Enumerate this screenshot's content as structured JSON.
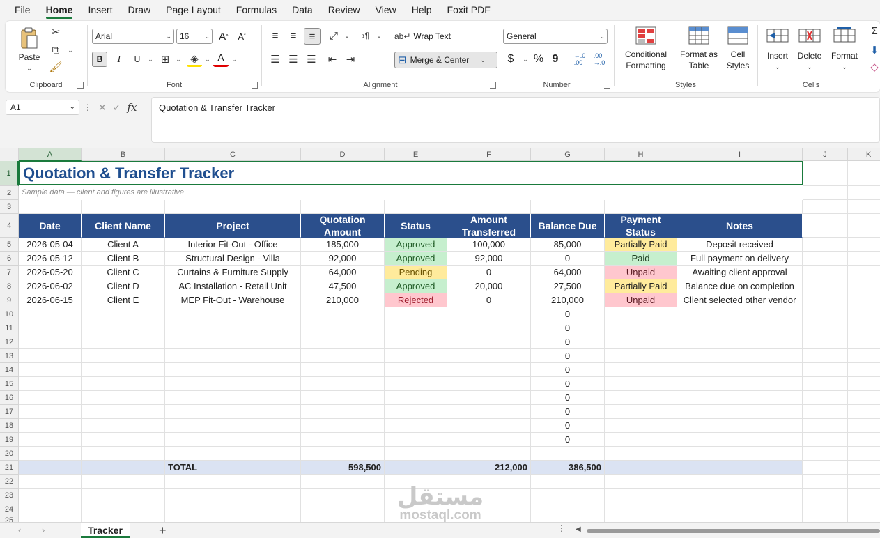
{
  "menu": [
    "File",
    "Home",
    "Insert",
    "Draw",
    "Page Layout",
    "Formulas",
    "Data",
    "Review",
    "View",
    "Help",
    "Foxit PDF"
  ],
  "ribbon": {
    "clipboard": {
      "paste_label": "Paste",
      "group_label": "Clipboard"
    },
    "font": {
      "font_name": "Arial",
      "font_size": "16",
      "bold": "B",
      "italic": "I",
      "underline": "U",
      "group_label": "Font"
    },
    "alignment": {
      "wrap_text": "Wrap Text",
      "merge_center": "Merge & Center",
      "group_label": "Alignment"
    },
    "number": {
      "format": "General",
      "currency": "$",
      "percent": "%",
      "comma": "9",
      "group_label": "Number"
    },
    "styles": {
      "conditional_formatting": "Conditional Formatting",
      "format_as_table": "Format as Table",
      "cell_styles": "Cell Styles",
      "group_label": "Styles"
    },
    "cells": {
      "insert": "Insert",
      "delete": "Delete",
      "format": "Format",
      "group_label": "Cells"
    }
  },
  "formula_bar": {
    "name_box": "A1",
    "fx": "fx",
    "content": "Quotation & Transfer Tracker"
  },
  "columns": [
    "A",
    "B",
    "C",
    "D",
    "E",
    "F",
    "G",
    "H",
    "I",
    "J",
    "K"
  ],
  "rows": [
    "1",
    "2",
    "3",
    "4",
    "5",
    "6",
    "7",
    "8",
    "9",
    "10",
    "11",
    "12",
    "13",
    "14",
    "15",
    "16",
    "17",
    "18",
    "19",
    "20",
    "21",
    "22",
    "23",
    "24",
    "25"
  ],
  "sheet": {
    "title": "Quotation & Transfer Tracker",
    "subtitle": "Sample data — client and figures are illustrative",
    "headers": [
      "Date",
      "Client Name",
      "Project",
      "Quotation Amount",
      "Status",
      "Amount Transferred",
      "Balance Due",
      "Payment Status",
      "Notes"
    ],
    "data": [
      [
        "2026-05-04",
        "Client A",
        "Interior Fit-Out - Office",
        "185,000",
        "Approved",
        "100,000",
        "85,000",
        "Partially Paid",
        "Deposit received"
      ],
      [
        "2026-05-12",
        "Client B",
        "Structural Design - Villa",
        "92,000",
        "Approved",
        "92,000",
        "0",
        "Paid",
        "Full payment on delivery"
      ],
      [
        "2026-05-20",
        "Client C",
        "Curtains & Furniture Supply",
        "64,000",
        "Pending",
        "0",
        "64,000",
        "Unpaid",
        "Awaiting client approval"
      ],
      [
        "2026-06-02",
        "Client D",
        "AC Installation - Retail Unit",
        "47,500",
        "Approved",
        "20,000",
        "27,500",
        "Partially Paid",
        "Balance due on completion"
      ],
      [
        "2026-06-15",
        "Client E",
        "MEP Fit-Out - Warehouse",
        "210,000",
        "Rejected",
        "0",
        "210,000",
        "Unpaid",
        "Client selected other vendor"
      ]
    ],
    "empty_balance": [
      "0",
      "0",
      "0",
      "0",
      "0",
      "0",
      "0",
      "0",
      "0",
      "0"
    ],
    "total": {
      "label": "TOTAL",
      "quotation": "598,500",
      "transferred": "212,000",
      "balance": "386,500"
    }
  },
  "watermark": {
    "arabic": "مستقل",
    "latin": "mostaql.com"
  },
  "sheet_tab": {
    "name": "Tracker",
    "add": "+"
  },
  "colors": {
    "header_bg": "#2b4f8c",
    "approved": "#c6efce",
    "pending": "#ffeb9c",
    "rejected": "#ffc7ce",
    "total_bg": "#dbe3f3",
    "accent": "#1a7a3c"
  }
}
